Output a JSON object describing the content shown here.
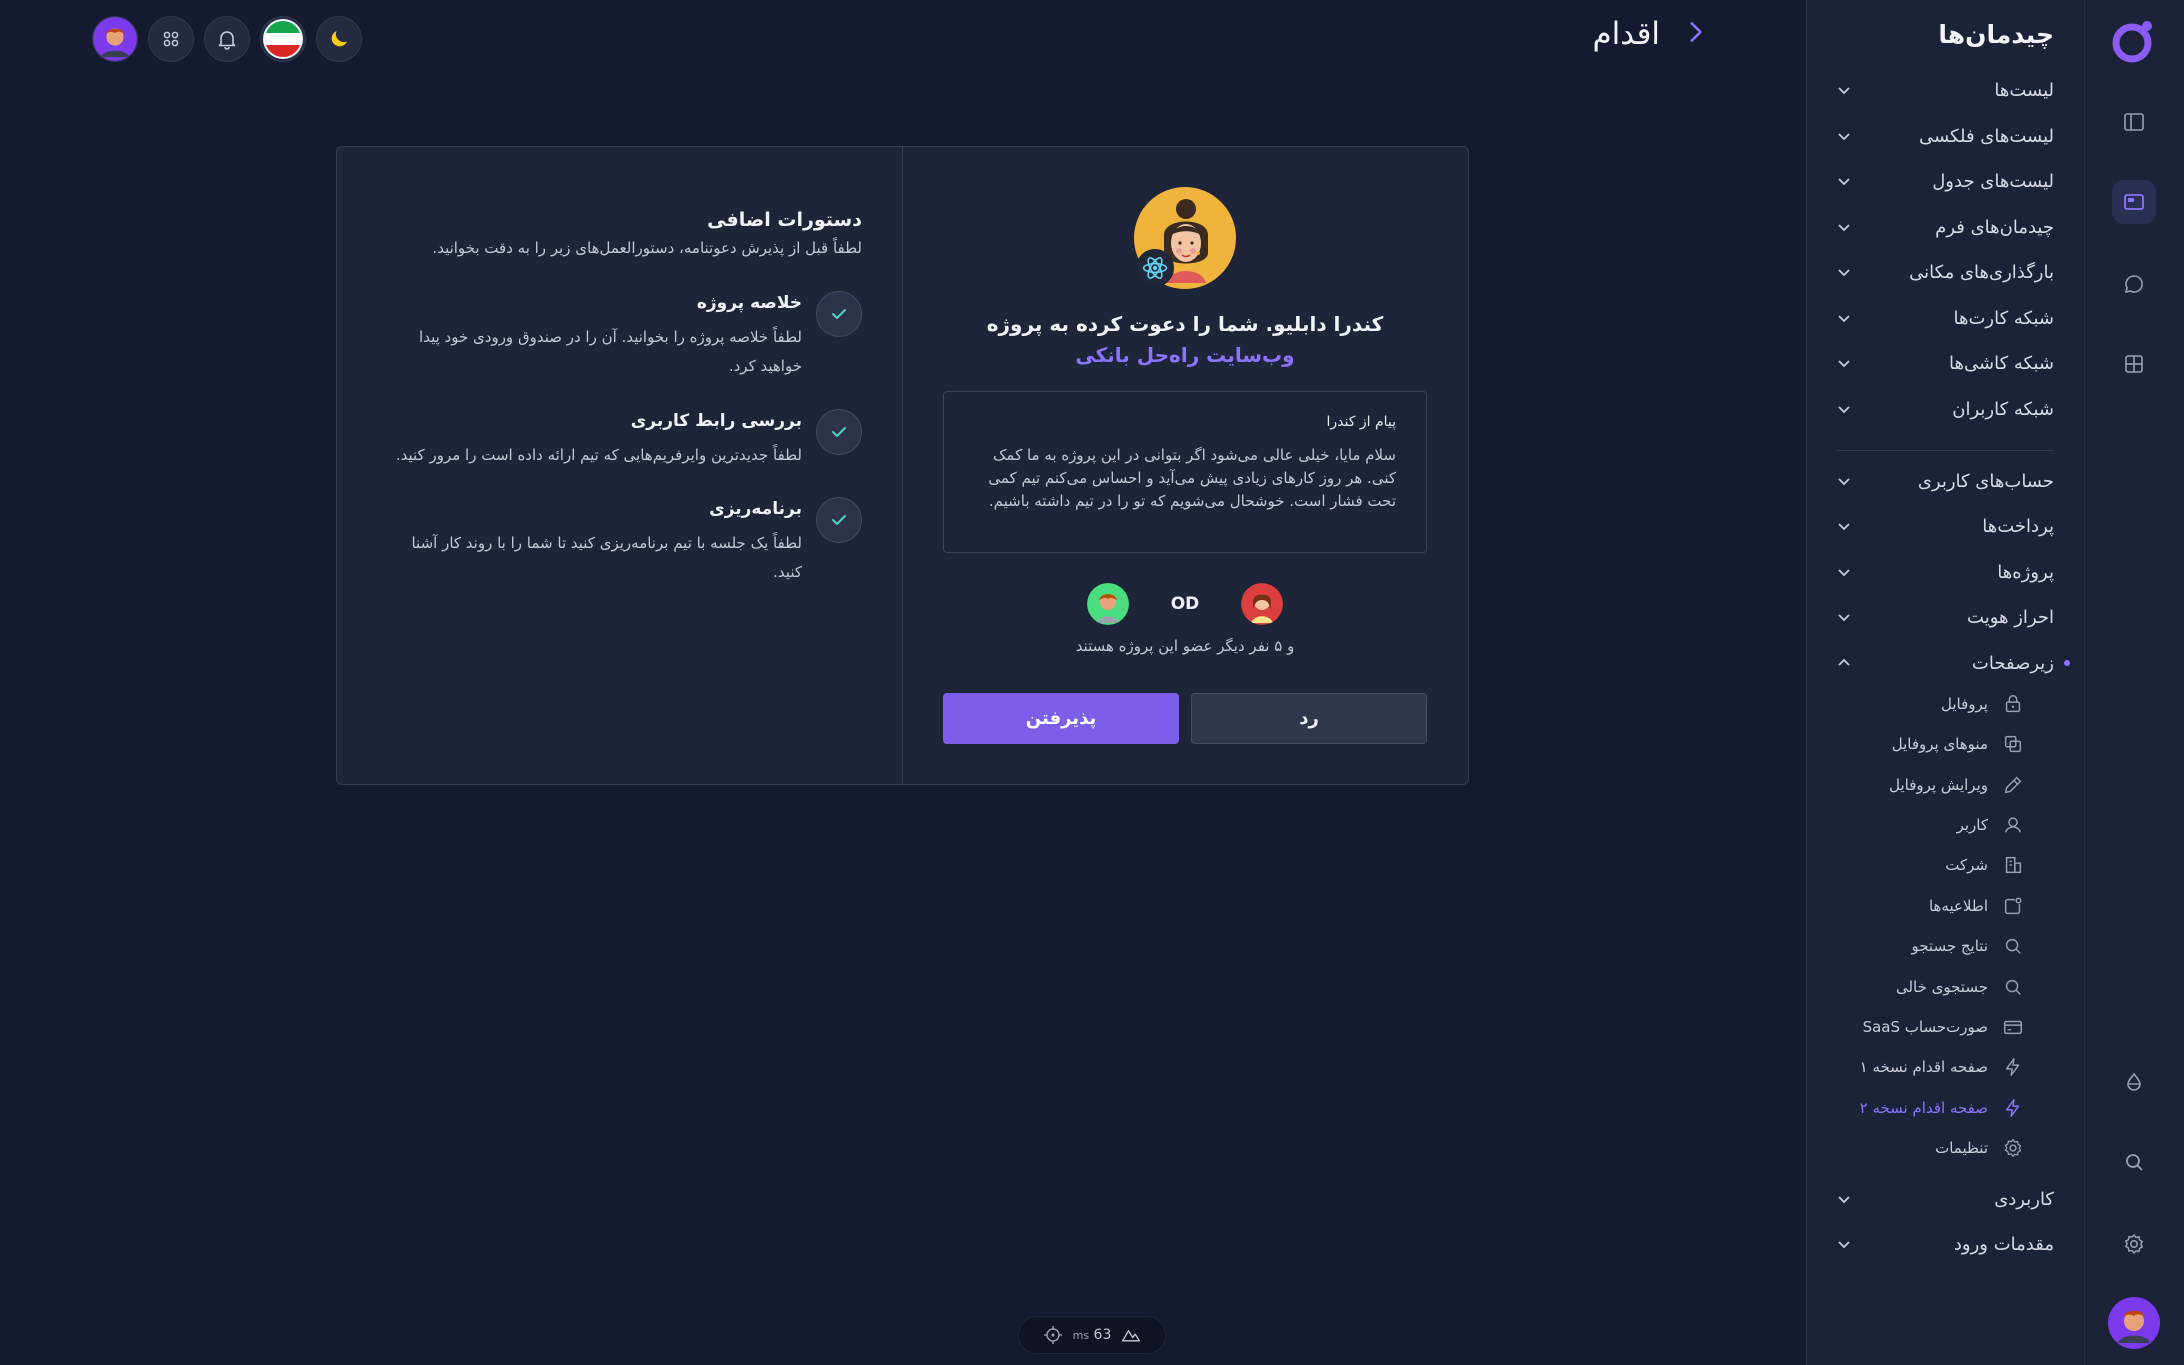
{
  "page": {
    "title": "اقدام"
  },
  "sidebar": {
    "title": "چیدمان‌ها",
    "groups": [
      {
        "label": "لیست‌ها"
      },
      {
        "label": "لیست‌های فلکسی"
      },
      {
        "label": "لیست‌های جدول"
      },
      {
        "label": "چیدمان‌های فرم"
      },
      {
        "label": "بارگذاری‌های مکانی"
      },
      {
        "label": "شبکه کارت‌ها"
      },
      {
        "label": "شبکه کاشی‌ها"
      },
      {
        "label": "شبکه کاربران"
      },
      {
        "label": "حساب‌های کاربری"
      },
      {
        "label": "پرداخت‌ها"
      },
      {
        "label": "پروژه‌ها"
      },
      {
        "label": "احراز هویت"
      },
      {
        "label": "زیرصفحات"
      },
      {
        "label": "کاربردی"
      },
      {
        "label": "مقدمات ورود"
      }
    ],
    "subpages": [
      {
        "label": "پروفایل",
        "icon": "lock-icon"
      },
      {
        "label": "منوهای پروفایل",
        "icon": "copy-icon"
      },
      {
        "label": "ویرایش پروفایل",
        "icon": "pencil-icon"
      },
      {
        "label": "کاربر",
        "icon": "user-icon"
      },
      {
        "label": "شرکت",
        "icon": "building-icon"
      },
      {
        "label": "اطلاعیه‌ها",
        "icon": "notification-icon"
      },
      {
        "label": "نتایج جستجو",
        "icon": "search-icon"
      },
      {
        "label": "جستجوی خالی",
        "icon": "search-icon"
      },
      {
        "label": "صورت‌حساب SaaS",
        "icon": "credit-card-icon"
      },
      {
        "label": "صفحه اقدام نسخه ۱",
        "icon": "bolt-icon"
      },
      {
        "label": "صفحه اقدام نسخه ۲",
        "icon": "bolt-icon",
        "active": true
      },
      {
        "label": "تنظیمات",
        "icon": "gear-icon"
      }
    ]
  },
  "invite": {
    "text_prefix": "کندرا دابلیو. شما را دعوت کرده به پروژه",
    "project_name": "وب‌سایت راه‌حل بانکی",
    "message_title": "پیام از کندرا",
    "message_body": "سلام مایا، خیلی عالی می‌شود اگر بتوانی در این پروژه به ما کمک کنی. هر روز کارهای زیادی پیش می‌آید و احساس می‌کنم تیم کمی تحت فشار است. خوشحال می‌شویم که تو را در تیم داشته باشیم.",
    "member_initials": "OD",
    "members_text": "و ۵ نفر دیگر عضو این پروژه هستند",
    "reject_label": "رد",
    "accept_label": "پذیرفتن"
  },
  "instructions": {
    "title": "دستورات اضافی",
    "subtitle": "لطفاً قبل از پذیرش دعوتنامه، دستورالعمل‌های زیر را به دقت بخوانید.",
    "steps": [
      {
        "title": "خلاصه پروژه",
        "desc": "لطفاً خلاصه پروژه را بخوانید. آن را در صندوق ورودی خود پیدا خواهید کرد."
      },
      {
        "title": "بررسی رابط کاربری",
        "desc": "لطفاً جدیدترین وایرفریم‌هایی که تیم ارائه داده است را مرور کنید."
      },
      {
        "title": "برنامه‌ریزی",
        "desc": "لطفاً یک جلسه با تیم برنامه‌ریزی کنید تا شما را با روند کار آشنا کنید."
      }
    ]
  },
  "perf": {
    "value": "63",
    "unit": "ms"
  },
  "colors": {
    "accent": "#7c5ee8",
    "link": "#8b73ff",
    "background": "#151a30",
    "panel": "#1c2237"
  }
}
